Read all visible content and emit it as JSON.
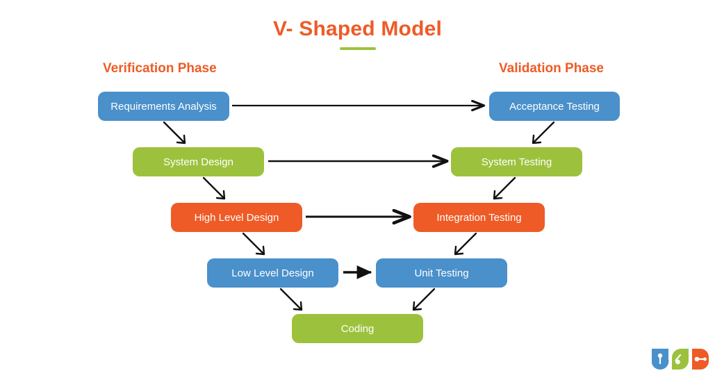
{
  "diagram": {
    "title": "V- Shaped Model",
    "phases": {
      "left": "Verification Phase",
      "right": "Validation Phase"
    },
    "colors": {
      "title": "#ee5b26",
      "title_underline": "#9cc23d",
      "phase_label": "#ee5b26",
      "blue": "#4a90cb",
      "green": "#9cc23d",
      "orange": "#ee5b26",
      "arrow": "#111111",
      "background": "#ffffff"
    },
    "nodes": [
      {
        "id": "requirements-analysis",
        "label": "Requirements Analysis",
        "color": "blue",
        "side": "left",
        "level": 1
      },
      {
        "id": "acceptance-testing",
        "label": "Acceptance Testing",
        "color": "blue",
        "side": "right",
        "level": 1
      },
      {
        "id": "system-design",
        "label": "System Design",
        "color": "green",
        "side": "left",
        "level": 2
      },
      {
        "id": "system-testing",
        "label": "System Testing",
        "color": "green",
        "side": "right",
        "level": 2
      },
      {
        "id": "high-level-design",
        "label": "High Level Design",
        "color": "orange",
        "side": "left",
        "level": 3
      },
      {
        "id": "integration-testing",
        "label": "Integration Testing",
        "color": "orange",
        "side": "right",
        "level": 3
      },
      {
        "id": "low-level-design",
        "label": "Low Level Design",
        "color": "blue",
        "side": "left",
        "level": 4
      },
      {
        "id": "unit-testing",
        "label": "Unit Testing",
        "color": "blue",
        "side": "right",
        "level": 4
      },
      {
        "id": "coding",
        "label": "Coding",
        "color": "green",
        "side": "center",
        "level": 5
      }
    ],
    "connections": [
      {
        "from": "requirements-analysis",
        "to": "acceptance-testing",
        "type": "horizontal"
      },
      {
        "from": "system-design",
        "to": "system-testing",
        "type": "horizontal"
      },
      {
        "from": "high-level-design",
        "to": "integration-testing",
        "type": "horizontal"
      },
      {
        "from": "low-level-design",
        "to": "unit-testing",
        "type": "horizontal"
      },
      {
        "from": "requirements-analysis",
        "to": "system-design",
        "type": "diagonal-down-right"
      },
      {
        "from": "system-design",
        "to": "high-level-design",
        "type": "diagonal-down-right"
      },
      {
        "from": "high-level-design",
        "to": "low-level-design",
        "type": "diagonal-down-right"
      },
      {
        "from": "low-level-design",
        "to": "coding",
        "type": "diagonal-down-right"
      },
      {
        "from": "acceptance-testing",
        "to": "system-testing",
        "type": "diagonal-down-left"
      },
      {
        "from": "system-testing",
        "to": "integration-testing",
        "type": "diagonal-down-left"
      },
      {
        "from": "integration-testing",
        "to": "unit-testing",
        "type": "diagonal-down-left"
      },
      {
        "from": "unit-testing",
        "to": "coding",
        "type": "diagonal-down-left"
      }
    ]
  },
  "logo": {
    "parts": [
      {
        "name": "shield-badge-icon",
        "color": "#4a90cb"
      },
      {
        "name": "leaf-icon",
        "color": "#9cc23d"
      },
      {
        "name": "pill-connector-icon",
        "color": "#ee5b26"
      }
    ]
  }
}
